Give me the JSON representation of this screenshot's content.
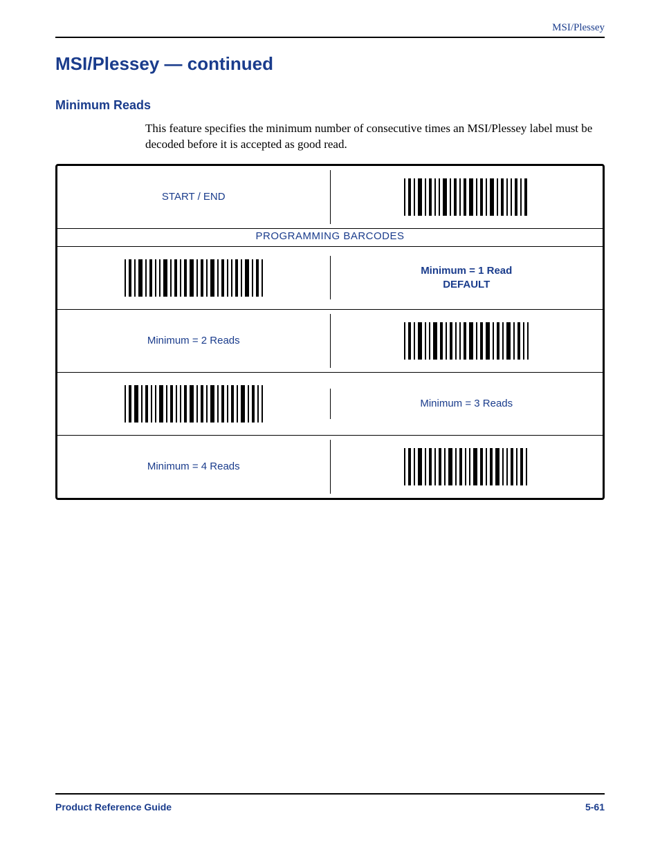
{
  "running_head": "MSI/Plessey",
  "section_title": "MSI/Plessey — continued",
  "subhead": "Minimum Reads",
  "body_text": "This feature specifies the minimum number of consecutive times an MSI/Plessey label must be decoded before it is accepted as good read.",
  "table": {
    "start_end_label": "START / END",
    "header": "PROGRAMMING BARCODES",
    "rows": [
      {
        "label_line1": "Minimum = 1 Read",
        "label_line2": "DEFAULT",
        "is_default": true,
        "barcode_left": true
      },
      {
        "label_line1": "Minimum = 2 Reads",
        "label_line2": "",
        "is_default": false,
        "barcode_left": false
      },
      {
        "label_line1": "Minimum = 3 Reads",
        "label_line2": "",
        "is_default": false,
        "barcode_left": true
      },
      {
        "label_line1": "Minimum = 4 Reads",
        "label_line2": "",
        "is_default": false,
        "barcode_left": false
      }
    ]
  },
  "footer": {
    "left": "Product Reference Guide",
    "right": "5-61"
  }
}
